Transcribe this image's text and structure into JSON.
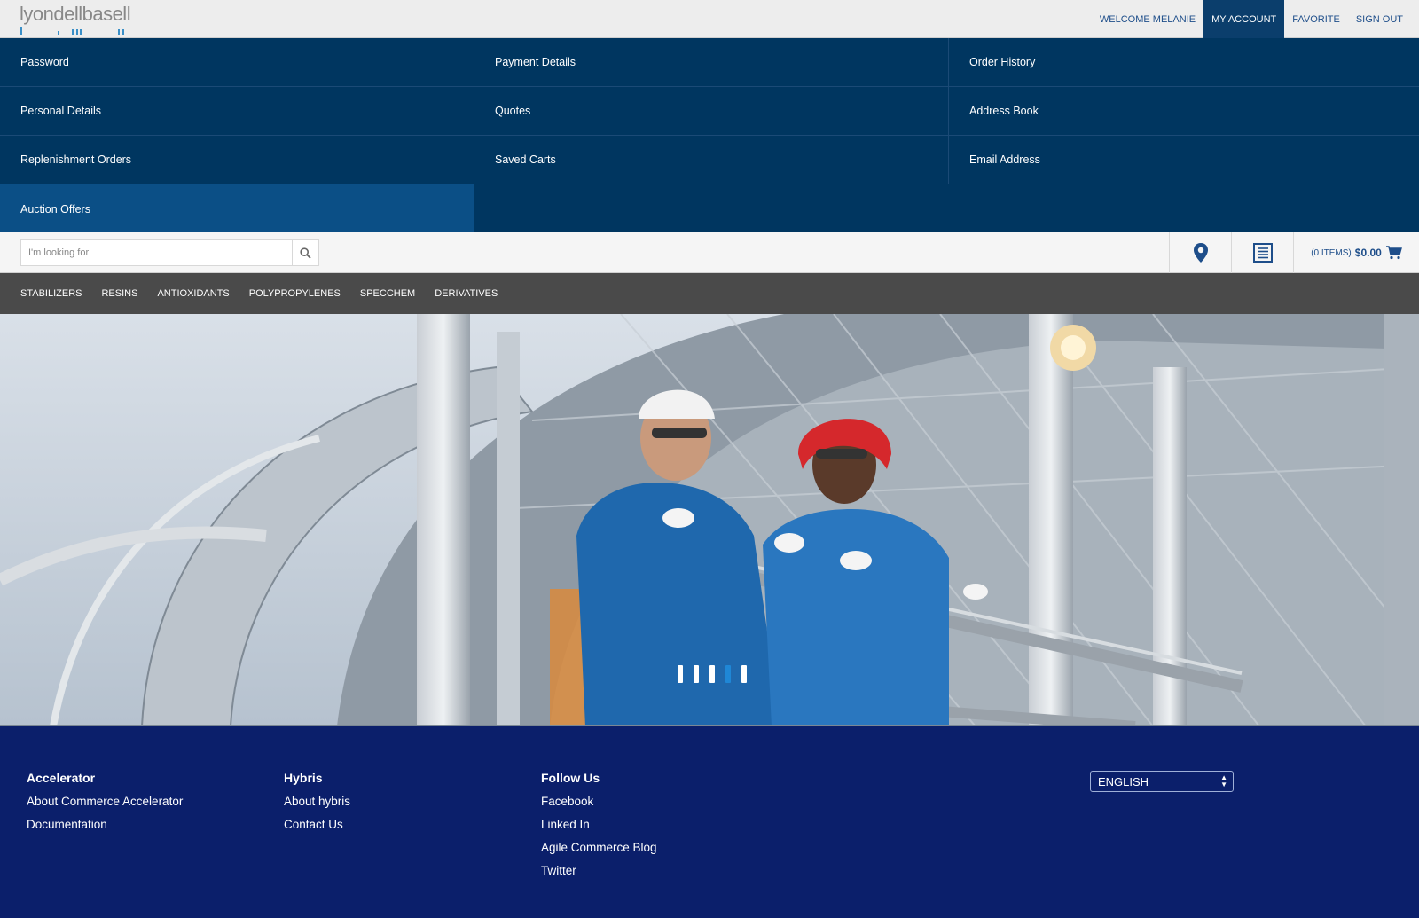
{
  "header": {
    "logo_text": "lyondellbasell",
    "links": [
      "WELCOME MELANIE",
      "MY ACCOUNT",
      "FAVORITE",
      "SIGN OUT"
    ],
    "active_link": "MY ACCOUNT"
  },
  "account_menu": {
    "items": [
      "Password",
      "Payment Details",
      "Order History",
      "Personal Details",
      "Quotes",
      "Address Book",
      "Replenishment Orders",
      "Saved Carts",
      "Email Address",
      "Auction Offers"
    ],
    "highlighted": "Auction Offers"
  },
  "search": {
    "placeholder": "I'm looking for",
    "icon": "search-icon"
  },
  "utilities": {
    "store_locator_icon": "map-pin-icon",
    "quick_order_icon": "list-icon",
    "cart_items": "(0 ITEMS)",
    "cart_total": "$0.00",
    "cart_icon": "cart-icon"
  },
  "categories": [
    "STABILIZERS",
    "RESINS",
    "ANTIOXIDANTS",
    "POLYPROPYLENES",
    "SPECCHEM",
    "DERIVATIVES"
  ],
  "hero": {
    "slide_count": 4,
    "active_slide": 3
  },
  "footer": {
    "columns": [
      {
        "heading": "Accelerator",
        "links": [
          "About Commerce Accelerator",
          "Documentation"
        ]
      },
      {
        "heading": "Hybris",
        "links": [
          "About hybris",
          "Contact Us"
        ]
      },
      {
        "heading": "Follow Us",
        "links": [
          "Facebook",
          "Linked In",
          "Agile Commerce Blog",
          "Twitter"
        ]
      }
    ],
    "language": "ENGLISH"
  },
  "colors": {
    "header_bg": "#ededed",
    "menu_bg": "#003660",
    "menu_highlight": "#0b4f86",
    "category_bg": "#4a4a4a",
    "footer_bg": "#0b1f6b",
    "link_blue": "#1e4e8a"
  }
}
